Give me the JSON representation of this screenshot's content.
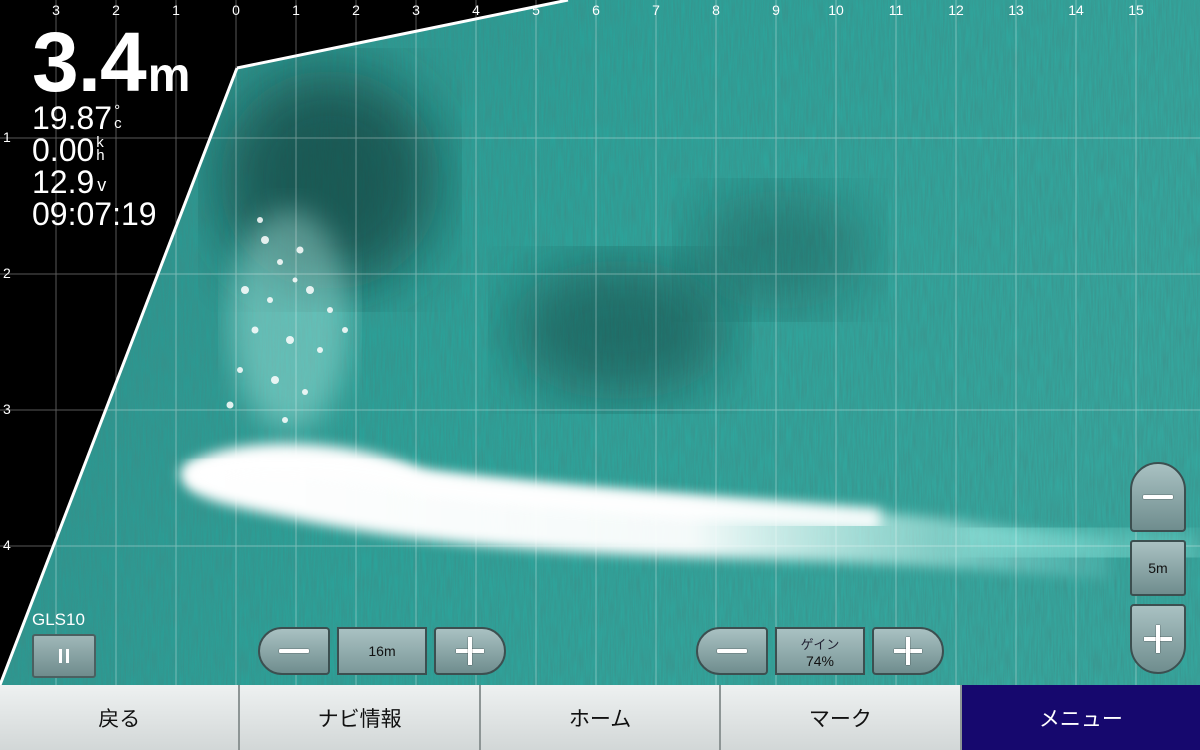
{
  "scale": {
    "top_labels": [
      "3",
      "2",
      "1",
      "0",
      "1",
      "2",
      "3",
      "4",
      "5",
      "6",
      "7",
      "8",
      "9",
      "10",
      "11",
      "12",
      "13",
      "14",
      "15"
    ],
    "left_labels": [
      "1",
      "2",
      "3",
      "4"
    ]
  },
  "readouts": {
    "depth": {
      "value": "3.4",
      "unit": "m"
    },
    "water_temp": {
      "value": "19.87",
      "unit_top": "°",
      "unit_bottom": "c"
    },
    "speed": {
      "value": "0.00",
      "unit_top": "k",
      "unit_bottom": "h"
    },
    "voltage": {
      "value": "12.9",
      "unit": "v"
    },
    "time": {
      "value": "09:07:19"
    }
  },
  "source": {
    "label": "GLS10"
  },
  "range_control": {
    "value": "16m"
  },
  "gain_control": {
    "label": "ゲイン",
    "value": "74%",
    "fraction": 0.74
  },
  "vertical_zoom": {
    "value": "5m"
  },
  "softkeys": [
    {
      "label": "戻る",
      "active": false
    },
    {
      "label": "ナビ情報",
      "active": false
    },
    {
      "label": "ホーム",
      "active": false
    },
    {
      "label": "マーク",
      "active": false
    },
    {
      "label": "メニュー",
      "active": true
    }
  ],
  "colors": {
    "sonar_base": "#2a9a92",
    "sonar_dark": "#0e3d3a",
    "echo_bright": "#ffffff",
    "active_softkey": "#16086e"
  },
  "icons": {
    "pause": "pause-icon",
    "minus": "minus-icon",
    "plus": "plus-icon"
  }
}
